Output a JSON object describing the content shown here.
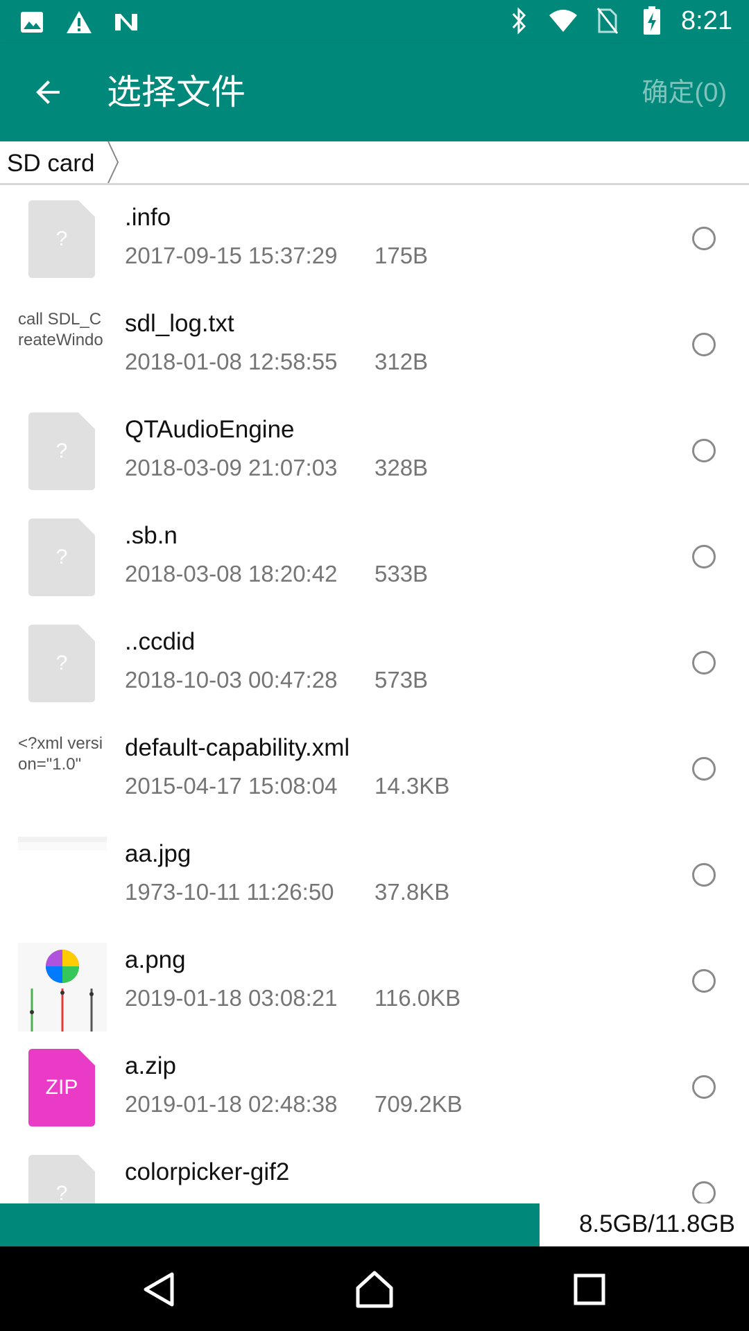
{
  "status_bar": {
    "time": "8:21",
    "left_icons": [
      "image-icon",
      "warning-icon",
      "n-icon"
    ],
    "right_icons": [
      "bluetooth-icon",
      "wifi-icon",
      "no-sim-icon",
      "battery-charging-icon"
    ]
  },
  "app_bar": {
    "title": "选择文件",
    "confirm_label": "确定(0)",
    "accent_color": "#00897b"
  },
  "breadcrumb": {
    "items": [
      "SD card"
    ]
  },
  "files": [
    {
      "name": ".info",
      "date": "2017-09-15 15:37:29",
      "size": "175B",
      "thumb_type": "unknown",
      "thumb_mark": "?"
    },
    {
      "name": "sdl_log.txt",
      "date": "2018-01-08 12:58:55",
      "size": "312B",
      "thumb_type": "text",
      "thumb_text": "call SDL_CreateWindo"
    },
    {
      "name": "QTAudioEngine",
      "date": "2018-03-09 21:07:03",
      "size": "328B",
      "thumb_type": "unknown",
      "thumb_mark": "?"
    },
    {
      "name": ".sb.n",
      "date": "2018-03-08 18:20:42",
      "size": "533B",
      "thumb_type": "unknown",
      "thumb_mark": "?"
    },
    {
      "name": "..ccdid",
      "date": "2018-10-03 00:47:28",
      "size": "573B",
      "thumb_type": "unknown",
      "thumb_mark": "?"
    },
    {
      "name": "default-capability.xml",
      "date": "2015-04-17 15:08:04",
      "size": "14.3KB",
      "thumb_type": "text",
      "thumb_text": "<?xml version=\"1.0\""
    },
    {
      "name": "aa.jpg",
      "date": "1973-10-11 11:26:50",
      "size": "37.8KB",
      "thumb_type": "blank-image"
    },
    {
      "name": "a.png",
      "date": "2019-01-18 03:08:21",
      "size": "116.0KB",
      "thumb_type": "colorwheel-image"
    },
    {
      "name": "a.zip",
      "date": "2019-01-18 02:48:38",
      "size": "709.2KB",
      "thumb_type": "zip",
      "thumb_mark": "ZIP"
    },
    {
      "name": "colorpicker-gif2",
      "date": "",
      "size": "",
      "thumb_type": "unknown",
      "thumb_mark": "?"
    }
  ],
  "storage": {
    "text": "8.5GB/11.8GB",
    "used_fraction": 0.72
  },
  "nav_bar": {
    "buttons": [
      "back-triangle-icon",
      "home-icon",
      "recents-icon"
    ]
  }
}
